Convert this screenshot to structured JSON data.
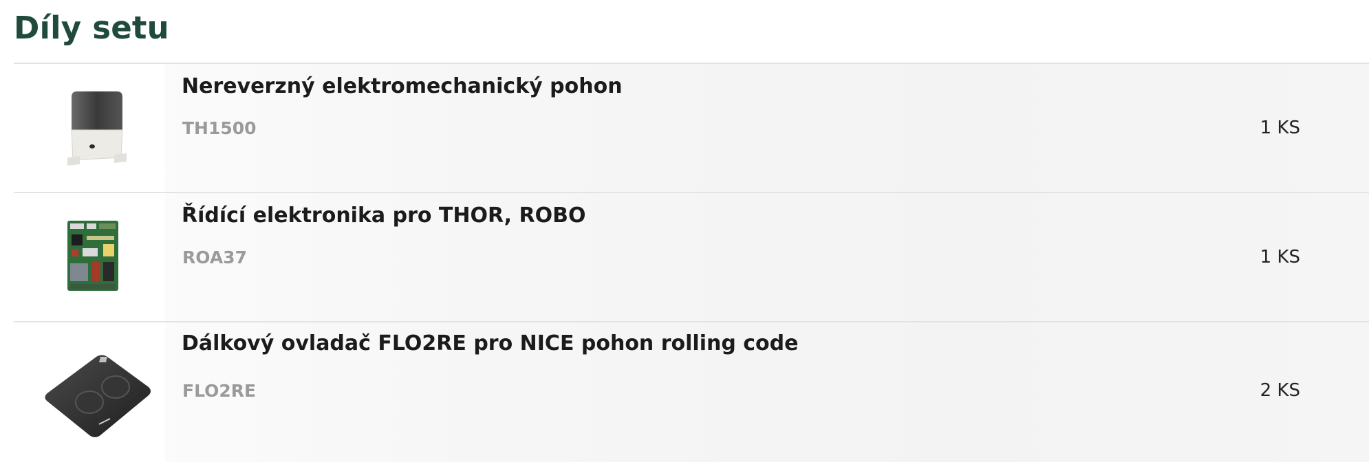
{
  "section": {
    "title": "Díly setu"
  },
  "parts": [
    {
      "name": "Nereverzný elektromechanický pohon",
      "code": "TH1500",
      "qty": "1 KS",
      "image_icon": "gate-motor-image"
    },
    {
      "name": "Řídící elektronika pro THOR, ROBO",
      "code": "ROA37",
      "qty": "1 KS",
      "image_icon": "control-board-image"
    },
    {
      "name": "Dálkový ovladač FLO2RE pro NICE pohon rolling code",
      "code": "FLO2RE",
      "qty": "2 KS",
      "image_icon": "remote-control-image"
    }
  ],
  "colors": {
    "title": "#1f4a3c",
    "name": "#1b1b1b",
    "code": "#9a9a9a",
    "divider": "#e3e3e3"
  }
}
